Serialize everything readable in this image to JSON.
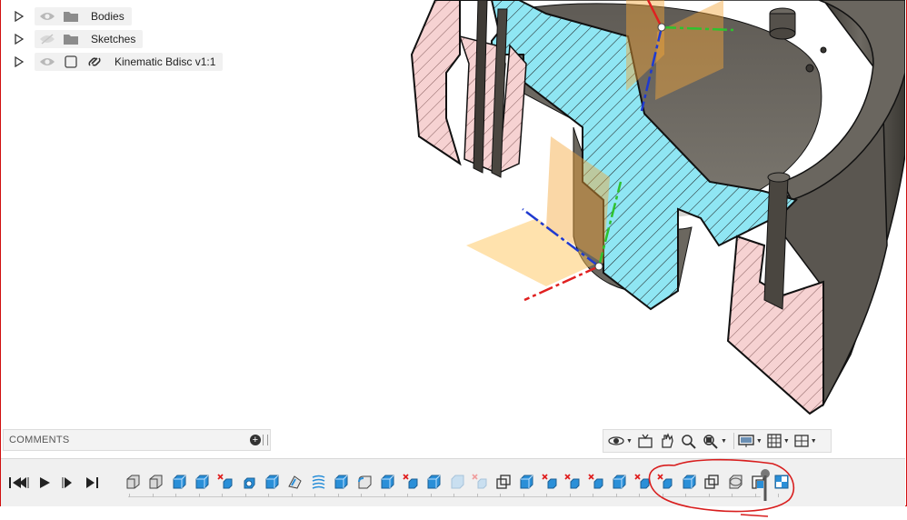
{
  "browser": {
    "items": [
      {
        "label": "Bodies",
        "type": "folder",
        "visible": true
      },
      {
        "label": "Sketches",
        "type": "folder",
        "visible": false
      },
      {
        "label": "Kinematic Bdisc v1:1",
        "type": "linked-component",
        "visible": true
      }
    ]
  },
  "comments": {
    "label": "COMMENTS"
  },
  "navigation_toolbar": {
    "tools": [
      "orbit",
      "look-at",
      "pan",
      "zoom",
      "zoom-window",
      "display-settings",
      "grid-settings",
      "viewports"
    ]
  },
  "timeline": {
    "controls": [
      "go-to-start",
      "step-back",
      "play",
      "step-forward",
      "go-to-end"
    ],
    "features": [
      "extrude",
      "extrude",
      "box",
      "box",
      "delete-body",
      "box-hole",
      "box",
      "shell",
      "coil",
      "box",
      "fillet",
      "box",
      "delete-body",
      "box",
      "box-disabled",
      "delete-body-disabled",
      "combine",
      "box",
      "delete-body",
      "delete-body",
      "delete-body",
      "box",
      "delete-body",
      "delete-body",
      "box",
      "combine",
      "split",
      "sketch-corner",
      "sketch-grid"
    ]
  },
  "colors": {
    "section_cyan": "#8fe6f3",
    "section_pink": "#f6d2d2",
    "body_gray": "#5b5750",
    "plane_orange": "#f3a63a",
    "annotation_red": "#d81e1e",
    "feature_blue": "#2a8fd8"
  }
}
